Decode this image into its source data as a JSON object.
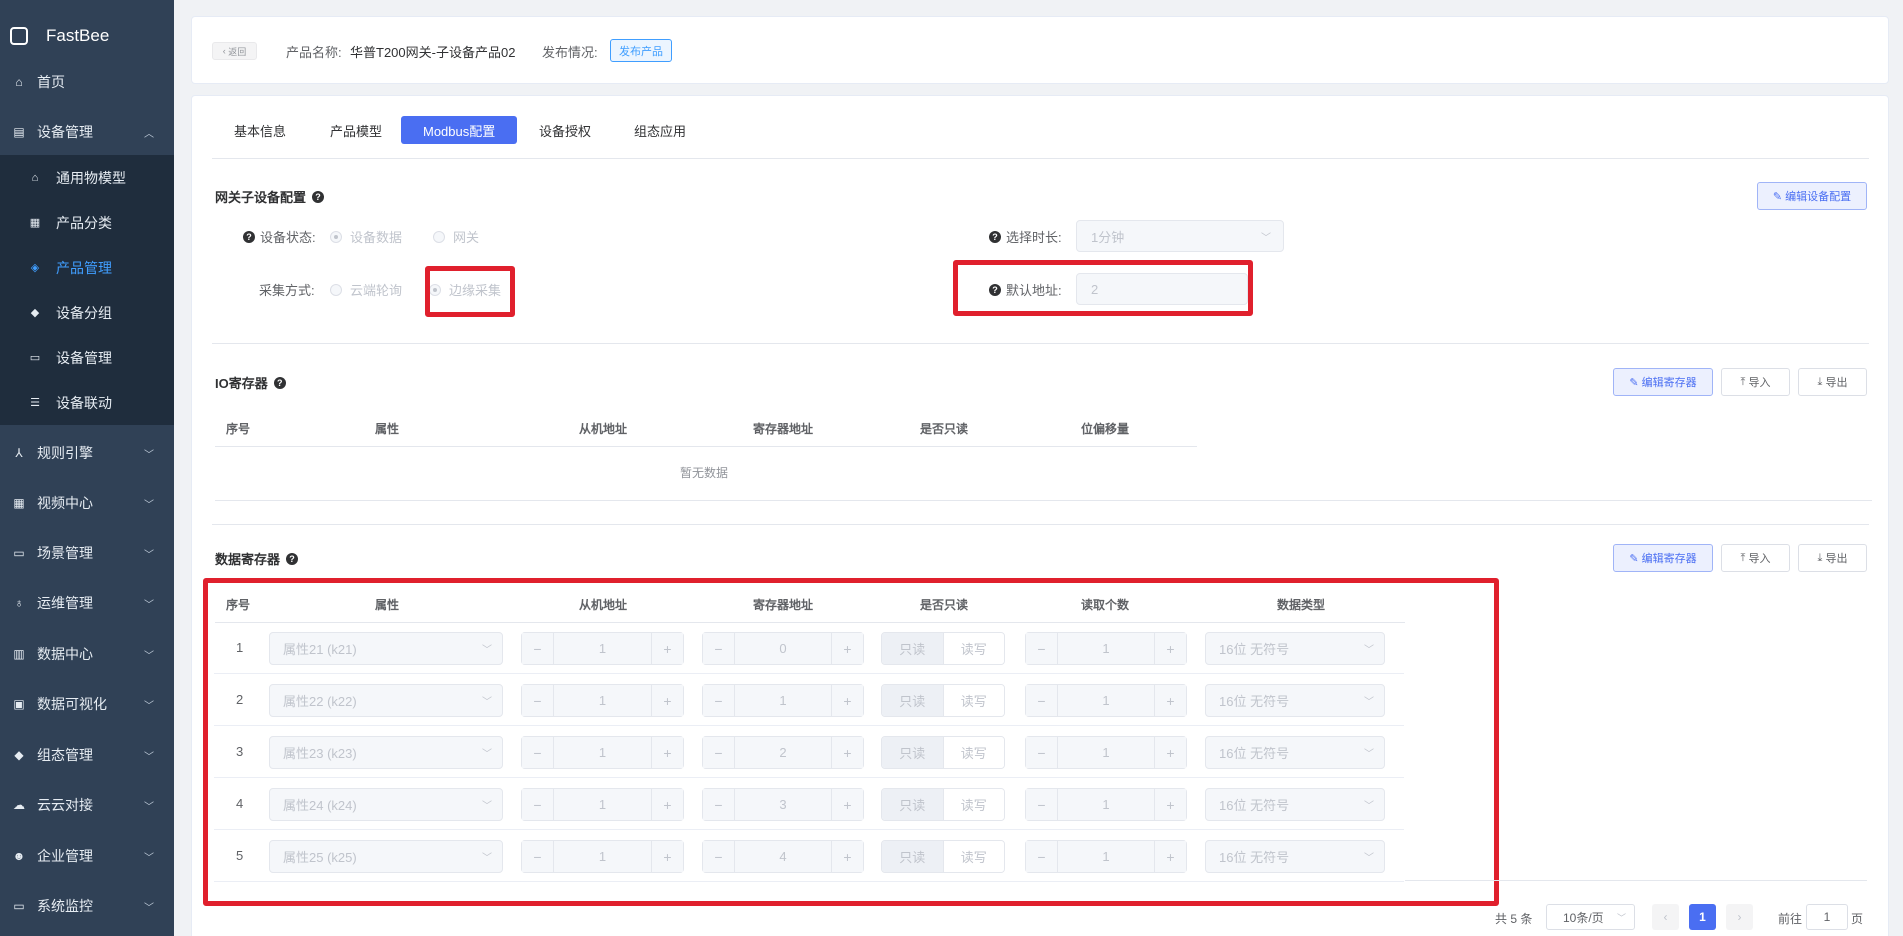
{
  "app": {
    "title": "FastBee"
  },
  "sidebar": {
    "items": [
      {
        "label": "首页",
        "icon": "home-icon"
      },
      {
        "label": "设备管理",
        "icon": "device-icon"
      },
      {
        "label": "规则引擎",
        "icon": "rule-icon"
      },
      {
        "label": "视频中心",
        "icon": "video-icon"
      },
      {
        "label": "场景管理",
        "icon": "scene-icon"
      },
      {
        "label": "运维管理",
        "icon": "ops-icon"
      },
      {
        "label": "数据中心",
        "icon": "data-icon"
      },
      {
        "label": "数据可视化",
        "icon": "visual-icon"
      },
      {
        "label": "组态管理",
        "icon": "config-icon"
      },
      {
        "label": "云云对接",
        "icon": "cloud-icon"
      },
      {
        "label": "企业管理",
        "icon": "enterprise-icon"
      },
      {
        "label": "系统监控",
        "icon": "monitor-icon"
      }
    ],
    "subitems": [
      {
        "label": "通用物模型"
      },
      {
        "label": "产品分类"
      },
      {
        "label": "产品管理"
      },
      {
        "label": "设备分组"
      },
      {
        "label": "设备管理"
      },
      {
        "label": "设备联动"
      }
    ]
  },
  "header": {
    "back": "返回",
    "product_label": "产品名称:",
    "product_name": "华普T200网关-子设备产品02",
    "publish_label": "发布情况:",
    "publish_button": "发布产品"
  },
  "tabs": [
    "基本信息",
    "产品模型",
    "Modbus配置",
    "设备授权",
    "组态应用"
  ],
  "gateway": {
    "title": "网关子设备配置",
    "edit_button": "编辑设备配置",
    "status_label": "设备状态:",
    "status_options": [
      "设备数据",
      "网关"
    ],
    "collect_label": "采集方式:",
    "collect_options": [
      "云端轮询",
      "边缘采集"
    ],
    "duration_label": "选择时长:",
    "duration_value": "1分钟",
    "address_label": "默认地址:",
    "address_value": "2"
  },
  "io": {
    "title": "IO寄存器",
    "edit_button": "编辑寄存器",
    "import_button": "导入",
    "export_button": "导出",
    "columns": [
      "序号",
      "属性",
      "从机地址",
      "寄存器地址",
      "是否只读",
      "位偏移量"
    ],
    "empty": "暂无数据"
  },
  "data_reg": {
    "title": "数据寄存器",
    "edit_button": "编辑寄存器",
    "import_button": "导入",
    "export_button": "导出",
    "columns": [
      "序号",
      "属性",
      "从机地址",
      "寄存器地址",
      "是否只读",
      "读取个数",
      "数据类型"
    ],
    "readonly_label": "只读",
    "readwrite_label": "读写",
    "rows": [
      {
        "no": "1",
        "attr": "属性21 (k21)",
        "slave": "1",
        "reg": "0",
        "count": "1",
        "dtype": "16位 无符号"
      },
      {
        "no": "2",
        "attr": "属性22 (k22)",
        "slave": "1",
        "reg": "1",
        "count": "1",
        "dtype": "16位 无符号"
      },
      {
        "no": "3",
        "attr": "属性23 (k23)",
        "slave": "1",
        "reg": "2",
        "count": "1",
        "dtype": "16位 无符号"
      },
      {
        "no": "4",
        "attr": "属性24 (k24)",
        "slave": "1",
        "reg": "3",
        "count": "1",
        "dtype": "16位 无符号"
      },
      {
        "no": "5",
        "attr": "属性25 (k25)",
        "slave": "1",
        "reg": "4",
        "count": "1",
        "dtype": "16位 无符号"
      }
    ]
  },
  "pagination": {
    "total": "共 5 条",
    "page_size": "10条/页",
    "current": "1",
    "goto_label": "前往",
    "goto_value": "1",
    "page_suffix": "页"
  },
  "colors": {
    "accent": "#4a6ef2",
    "highlight": "#e0202d",
    "sidebar": "#304156"
  }
}
